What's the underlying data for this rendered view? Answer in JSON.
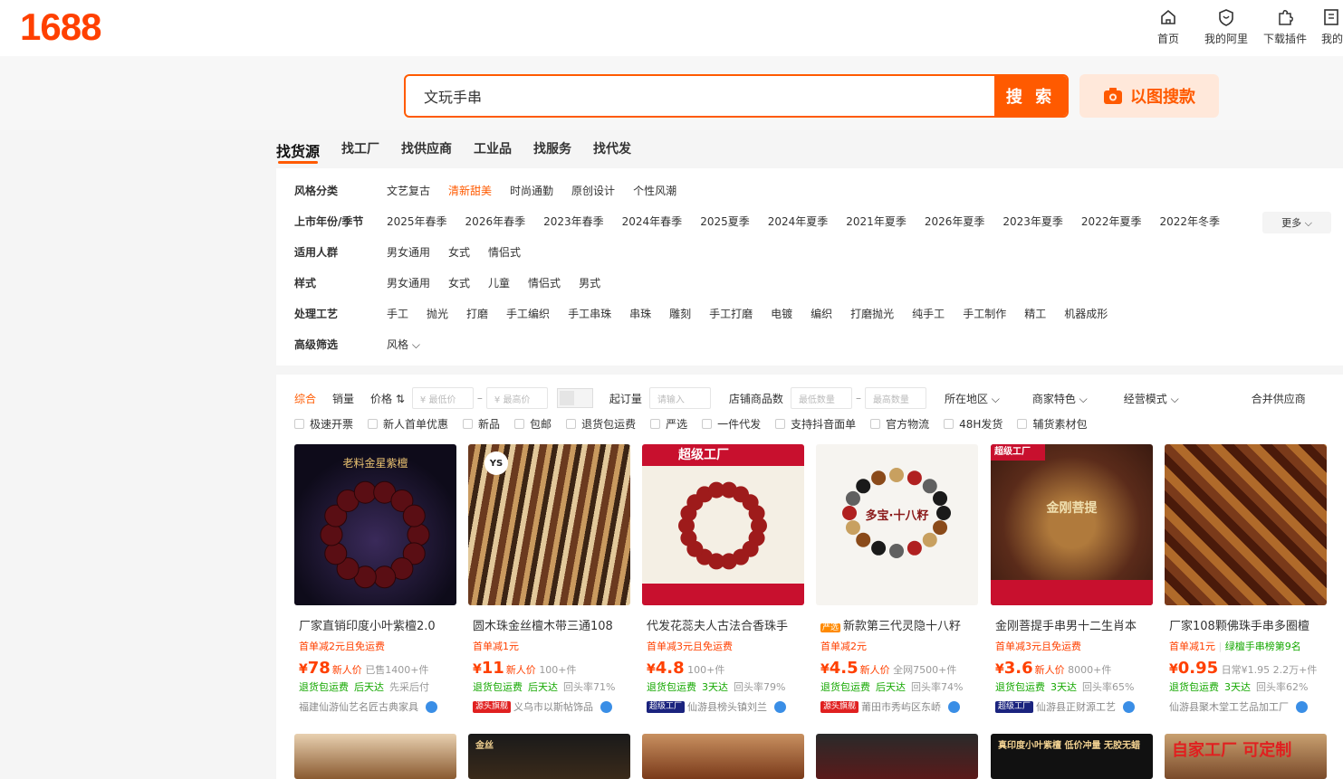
{
  "header": {
    "logo": "1688",
    "nav": [
      {
        "label": "首页",
        "icon": "home-icon"
      },
      {
        "label": "我的阿里",
        "icon": "shield-heart-icon"
      },
      {
        "label": "下载插件",
        "icon": "puzzle-icon"
      },
      {
        "label": "我的",
        "icon": "document-icon"
      }
    ]
  },
  "search": {
    "value": "文玩手串",
    "button": "搜 索",
    "image_search": "以图搜款"
  },
  "tabs": [
    "找货源",
    "找工厂",
    "找供应商",
    "工业品",
    "找服务",
    "找代发"
  ],
  "filters": {
    "rows": [
      {
        "label": "风格分类",
        "options": [
          "文艺复古",
          "清新甜美",
          "时尚通勤",
          "原创设计",
          "个性风潮"
        ],
        "selected": 1
      },
      {
        "label": "上市年份/季节",
        "options": [
          "2025年春季",
          "2026年春季",
          "2023年春季",
          "2024年春季",
          "2025夏季",
          "2024年夏季",
          "2021年夏季",
          "2026年夏季",
          "2023年夏季",
          "2022年夏季",
          "2022年冬季"
        ]
      },
      {
        "label": "适用人群",
        "options": [
          "男女通用",
          "女式",
          "情侣式"
        ]
      },
      {
        "label": "样式",
        "options": [
          "男女通用",
          "女式",
          "儿童",
          "情侣式",
          "男式"
        ]
      },
      {
        "label": "处理工艺",
        "options": [
          "手工",
          "抛光",
          "打磨",
          "手工编织",
          "手工串珠",
          "串珠",
          "雕刻",
          "手工打磨",
          "电镀",
          "编织",
          "打磨抛光",
          "纯手工",
          "手工制作",
          "精工",
          "机器成形"
        ]
      },
      {
        "label": "高级筛选",
        "options": [
          "风格 ⌵"
        ]
      }
    ],
    "more": "更多 ⌵"
  },
  "sort": {
    "items": [
      "综合",
      "销量",
      "价格 ⇅"
    ],
    "min_price": "¥ 最低价",
    "max_price": "¥ 最高价",
    "moq_label": "起订量",
    "moq_placeholder": "请输入",
    "shop_count_label": "店铺商品数",
    "min_count": "最低数量",
    "max_count": "最高数量",
    "region": "所在地区 ⌵",
    "merchant": "商家特色 ⌵",
    "mode": "经营模式 ⌵",
    "merge": "合并供应商",
    "checks": [
      "极速开票",
      "新人首单优惠",
      "新品",
      "包邮",
      "退货包运费",
      "严选",
      "一件代发",
      "支持抖音面单",
      "官方物流",
      "48H发货",
      "辅货素材包"
    ]
  },
  "products": [
    {
      "title": "厂家直销印度小叶紫檀2.0",
      "promo": "首单减2元且免运费",
      "yen": "¥",
      "price": "78",
      "tag": "新人价",
      "extra": "已售1400+件",
      "svc": [
        "退货包运费",
        "后天达"
      ],
      "svc2": "先采后付",
      "badge": "",
      "shop": "福建仙游仙艺名匠古典家具",
      "img_text": "老料金星紫檀"
    },
    {
      "title": "圆木珠金丝檀木带三通108",
      "promo": "首单减1元",
      "yen": "¥",
      "price": "11",
      "tag": "新人价",
      "extra": "100+件",
      "svc": [
        "退货包运费",
        "后天达"
      ],
      "svc2": "回头率71%",
      "badge": "源头旗舰",
      "shop": "义乌市以斯帖饰品",
      "img_text": "YS"
    },
    {
      "title": "代发花蕊夫人古法合香珠手",
      "promo": "首单减3元且免运费",
      "yen": "¥",
      "price": "4.8",
      "tag": "",
      "extra": "100+件",
      "svc": [
        "退货包运费",
        "3天达"
      ],
      "svc2": "回头率79%",
      "badge": "超级工厂",
      "shop": "仙游县榜头镇刘兰",
      "img_text": "超级工厂"
    },
    {
      "title": "新款第三代灵隐十八籽",
      "promo": "首单减2元",
      "yen": "¥",
      "price": "4.5",
      "tag": "新人价",
      "extra": "全网7500+件",
      "svc": [
        "退货包运费",
        "后天达"
      ],
      "svc2": "回头率74%",
      "badge": "源头旗舰",
      "shop": "莆田市秀屿区东峤",
      "img_text": "多宝·十八籽",
      "title_badge": "严选"
    },
    {
      "title": "金刚菩提手串男十二生肖本",
      "promo": "首单减3元且免运费",
      "yen": "¥",
      "price": "3.6",
      "tag": "新人价",
      "extra": "8000+件",
      "svc": [
        "退货包运费",
        "3天达"
      ],
      "svc2": "回头率65%",
      "badge": "超级工厂",
      "shop": "仙游县正财源工艺",
      "img_text": "金刚菩提"
    },
    {
      "title": "厂家108颗佛珠手串多圈檀",
      "promo": "首单减1元",
      "promo2": "绿檀手串榜第9名",
      "yen": "¥",
      "price": "0.95",
      "tag": "",
      "extra": "日常¥1.95 2.2万+件",
      "svc": [
        "退货包运费",
        "3天达"
      ],
      "svc2": "回头率62%",
      "badge": "",
      "shop": "仙游县聚木堂工艺品加工厂",
      "img_text": ""
    }
  ],
  "row2_texts": [
    "",
    "金丝",
    "",
    "",
    "真印度小叶紫檀 低价冲量 无胶无蜡",
    "自家工厂 可定制"
  ],
  "colors": {
    "accent": "#ff5a00",
    "price": "#ff4000",
    "service": "#14a800",
    "badge_red": "#e02020",
    "badge_navy": "#1a237e"
  }
}
